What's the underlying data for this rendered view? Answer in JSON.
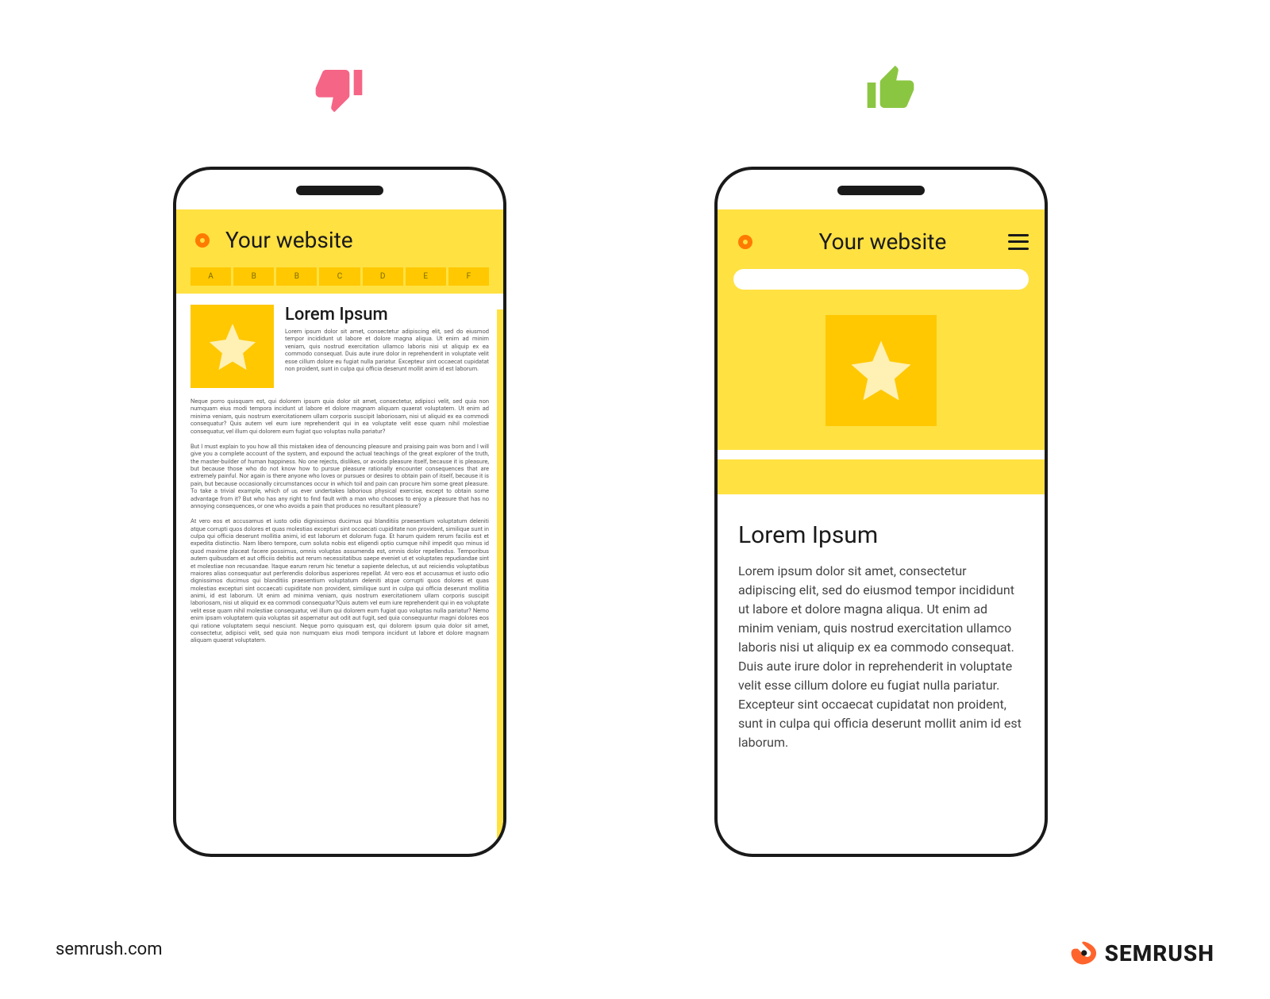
{
  "colors": {
    "yellow": "#ffe142",
    "yellow_dark": "#ffc800",
    "accent_orange": "#ff7a00",
    "thumb_down": "#f56586",
    "thumb_up": "#8bc642"
  },
  "icons": {
    "thumb_down": "thumb-down",
    "thumb_up": "thumb-up",
    "star": "star",
    "hamburger": "hamburger-menu"
  },
  "bad": {
    "site_title": "Your website",
    "tabs": [
      "A",
      "B",
      "B",
      "C",
      "D",
      "E",
      "F"
    ],
    "heading": "Lorem Ipsum",
    "intro": "Lorem ipsum dolor sit amet, consectetur adipiscing elit, sed do eiusmod tempor incididunt ut labore et dolore magna aliqua. Ut enim ad minim veniam, quis nostrud exercitation ullamco laboris nisi ut aliquip ex ea commodo consequat. Duis aute irure dolor in reprehenderit in voluptate velit esse cillum dolore eu fugiat nulla pariatur. Excepteur sint occaecat cupidatat non proident, sunt in culpa qui officia deserunt mollit anim id est laborum.",
    "p1": "Neque porro quisquam est, qui dolorem ipsum quia dolor sit amet, consectetur, adipisci velit, sed quia non numquam eius modi tempora incidunt ut labore et dolore magnam aliquam quaerat voluptatem. Ut enim ad minima veniam, quis nostrum exercitationem ullam corporis suscipit laboriosam, nisi ut aliquid ex ea commodi consequatur? Quis autem vel eum iure reprehenderit qui in ea voluptate velit esse quam nihil molestiae consequatur, vel illum qui dolorem eum fugiat quo voluptas nulla pariatur?",
    "p2": "But I must explain to you how all this mistaken idea of denouncing pleasure and praising pain was born and I will give you a complete account of the system, and expound the actual teachings of the great explorer of the truth, the master-builder of human happiness. No one rejects, dislikes, or avoids pleasure itself, because it is pleasure, but because those who do not know how to pursue pleasure rationally encounter consequences that are extremely painful. Nor again is there anyone who loves or pursues or desires to obtain pain of itself, because it is pain, but because occasionally circumstances occur in which toil and pain can procure him some great pleasure. To take a trivial example, which of us ever undertakes laborious physical exercise, except to obtain some advantage from it? But who has any right to find fault with a man who chooses to enjoy a pleasure that has no annoying consequences, or one who avoids a pain that produces no resultant pleasure?",
    "p3": "At vero eos et accusamus et iusto odio dignissimos ducimus qui blanditiis praesentium voluptatum deleniti atque corrupti quos dolores et quas molestias excepturi sint occaecati cupiditate non provident, similique sunt in culpa qui officia deserunt mollitia animi, id est laborum et dolorum fuga. Et harum quidem rerum facilis est et expedita distinctio. Nam libero tempore, cum soluta nobis est eligendi optio cumque nihil impedit quo minus id quod maxime placeat facere possimus, omnis voluptas assumenda est, omnis dolor repellendus. Temporibus autem quibusdam et aut officiis debitis aut rerum necessitatibus saepe eveniet ut et voluptates repudiandae sint et molestiae non recusandae. Itaque earum rerum hic tenetur a sapiente delectus, ut aut reiciendis voluptatibus maiores alias consequatur aut perferendis doloribus asperiores repellat. At vero eos et accusamus et iusto odio dignissimos ducimus qui blanditiis praesentium voluptatum deleniti atque corrupti quos dolores et quas molestias excepturi sint occaecati cupiditate non provident, similique sunt in culpa qui officia deserunt mollitia animi, id est laborum. Ut enim ad minima veniam, quis nostrum exercitationem ullam corporis suscipit laboriosam, nisi ut aliquid ex ea commodi consequatur?Quis autem vel eum iure reprehenderit qui in ea voluptate velit esse quam nihil molestiae consequatur, vel illum qui dolorem eum fugiat quo voluptas nulla pariatur? Nemo enim ipsam voluptatem quia voluptas sit aspernatur aut odit aut fugit, sed quia consequuntur magni dolores eos qui ratione voluptatem sequi nesciunt. Neque porro quisquam est, qui dolorem ipsum quia dolor sit amet, consectetur, adipisci velit, sed quia non numquam eius modi tempora incidunt ut labore et dolore magnam aliquam quaerat voluptatem."
  },
  "good": {
    "site_title": "Your website",
    "heading": "Lorem Ipsum",
    "body": "Lorem ipsum dolor sit amet, consectetur adipiscing elit, sed do eiusmod tempor incididunt ut labore et dolore magna aliqua. Ut enim ad minim veniam, quis nostrud exercitation ullamco laboris nisi ut aliquip ex ea commodo consequat. Duis aute irure dolor in reprehenderit in voluptate velit esse cillum dolore eu fugiat nulla pariatur. Excepteur sint occaecat cupidatat non proident, sunt in culpa qui officia deserunt mollit anim id est laborum."
  },
  "footer": {
    "url": "semrush.com",
    "brand": "SEMRUSH"
  }
}
